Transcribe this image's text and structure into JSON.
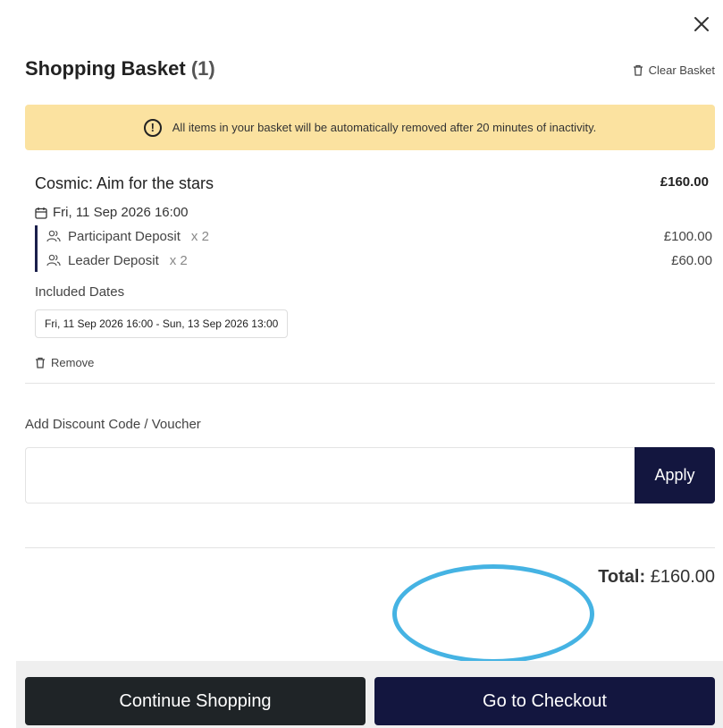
{
  "modal": {
    "close_icon": "close-icon",
    "title": "Shopping Basket",
    "count": "(1)",
    "clear_label": "Clear Basket",
    "clear_icon": "trash-icon"
  },
  "notice": {
    "icon": "exclamation-circle-icon",
    "text": "All items in your basket will be automatically removed after 20 minutes of inactivity.",
    "background": "#fbe2a0"
  },
  "basket": {
    "items": [
      {
        "name": "Cosmic: Aim for the stars",
        "price": "£160.00",
        "date_icon": "calendar-icon",
        "date": "Fri, 11 Sep 2026 16:00",
        "tickets": [
          {
            "icon": "people-icon",
            "label": "Participant Deposit",
            "qty": "x 2",
            "price": "£100.00"
          },
          {
            "icon": "people-icon",
            "label": "Leader Deposit",
            "qty": "x 2",
            "price": "£60.00"
          }
        ],
        "included_dates_label": "Included Dates",
        "included_dates": [
          "Fri, 11 Sep 2026 16:00 - Sun, 13 Sep 2026 13:00"
        ],
        "remove_label": "Remove",
        "remove_icon": "trash-icon"
      }
    ]
  },
  "discount": {
    "label": "Add Discount Code / Voucher",
    "value": "",
    "placeholder": "",
    "apply_label": "Apply"
  },
  "summary": {
    "total_label": "Total:",
    "total_value": "£160.00"
  },
  "footer": {
    "continue_label": "Continue Shopping",
    "checkout_label": "Go to Checkout"
  },
  "colors": {
    "primary": "#13163f",
    "dark": "#1f2427",
    "notice": "#fbe2a0",
    "annotation": "#45b3e3"
  }
}
